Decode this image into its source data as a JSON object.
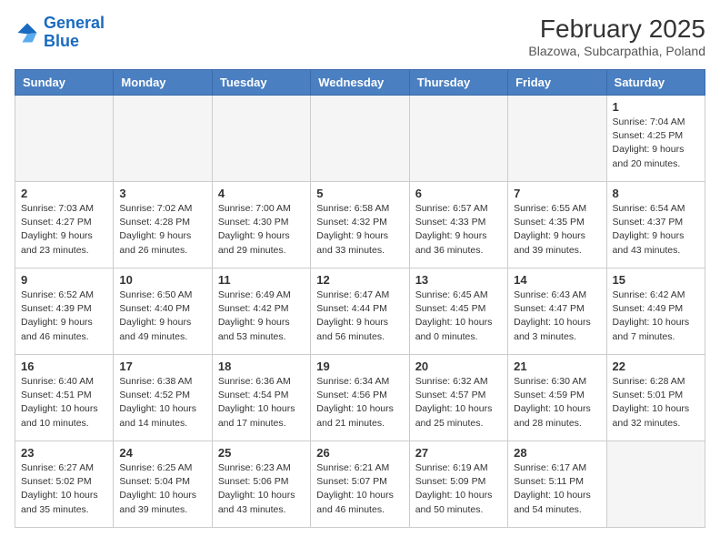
{
  "header": {
    "logo_general": "General",
    "logo_blue": "Blue",
    "month_year": "February 2025",
    "location": "Blazowa, Subcarpathia, Poland"
  },
  "weekdays": [
    "Sunday",
    "Monday",
    "Tuesday",
    "Wednesday",
    "Thursday",
    "Friday",
    "Saturday"
  ],
  "weeks": [
    [
      {
        "day": "",
        "info": ""
      },
      {
        "day": "",
        "info": ""
      },
      {
        "day": "",
        "info": ""
      },
      {
        "day": "",
        "info": ""
      },
      {
        "day": "",
        "info": ""
      },
      {
        "day": "",
        "info": ""
      },
      {
        "day": "1",
        "info": "Sunrise: 7:04 AM\nSunset: 4:25 PM\nDaylight: 9 hours\nand 20 minutes."
      }
    ],
    [
      {
        "day": "2",
        "info": "Sunrise: 7:03 AM\nSunset: 4:27 PM\nDaylight: 9 hours\nand 23 minutes."
      },
      {
        "day": "3",
        "info": "Sunrise: 7:02 AM\nSunset: 4:28 PM\nDaylight: 9 hours\nand 26 minutes."
      },
      {
        "day": "4",
        "info": "Sunrise: 7:00 AM\nSunset: 4:30 PM\nDaylight: 9 hours\nand 29 minutes."
      },
      {
        "day": "5",
        "info": "Sunrise: 6:58 AM\nSunset: 4:32 PM\nDaylight: 9 hours\nand 33 minutes."
      },
      {
        "day": "6",
        "info": "Sunrise: 6:57 AM\nSunset: 4:33 PM\nDaylight: 9 hours\nand 36 minutes."
      },
      {
        "day": "7",
        "info": "Sunrise: 6:55 AM\nSunset: 4:35 PM\nDaylight: 9 hours\nand 39 minutes."
      },
      {
        "day": "8",
        "info": "Sunrise: 6:54 AM\nSunset: 4:37 PM\nDaylight: 9 hours\nand 43 minutes."
      }
    ],
    [
      {
        "day": "9",
        "info": "Sunrise: 6:52 AM\nSunset: 4:39 PM\nDaylight: 9 hours\nand 46 minutes."
      },
      {
        "day": "10",
        "info": "Sunrise: 6:50 AM\nSunset: 4:40 PM\nDaylight: 9 hours\nand 49 minutes."
      },
      {
        "day": "11",
        "info": "Sunrise: 6:49 AM\nSunset: 4:42 PM\nDaylight: 9 hours\nand 53 minutes."
      },
      {
        "day": "12",
        "info": "Sunrise: 6:47 AM\nSunset: 4:44 PM\nDaylight: 9 hours\nand 56 minutes."
      },
      {
        "day": "13",
        "info": "Sunrise: 6:45 AM\nSunset: 4:45 PM\nDaylight: 10 hours\nand 0 minutes."
      },
      {
        "day": "14",
        "info": "Sunrise: 6:43 AM\nSunset: 4:47 PM\nDaylight: 10 hours\nand 3 minutes."
      },
      {
        "day": "15",
        "info": "Sunrise: 6:42 AM\nSunset: 4:49 PM\nDaylight: 10 hours\nand 7 minutes."
      }
    ],
    [
      {
        "day": "16",
        "info": "Sunrise: 6:40 AM\nSunset: 4:51 PM\nDaylight: 10 hours\nand 10 minutes."
      },
      {
        "day": "17",
        "info": "Sunrise: 6:38 AM\nSunset: 4:52 PM\nDaylight: 10 hours\nand 14 minutes."
      },
      {
        "day": "18",
        "info": "Sunrise: 6:36 AM\nSunset: 4:54 PM\nDaylight: 10 hours\nand 17 minutes."
      },
      {
        "day": "19",
        "info": "Sunrise: 6:34 AM\nSunset: 4:56 PM\nDaylight: 10 hours\nand 21 minutes."
      },
      {
        "day": "20",
        "info": "Sunrise: 6:32 AM\nSunset: 4:57 PM\nDaylight: 10 hours\nand 25 minutes."
      },
      {
        "day": "21",
        "info": "Sunrise: 6:30 AM\nSunset: 4:59 PM\nDaylight: 10 hours\nand 28 minutes."
      },
      {
        "day": "22",
        "info": "Sunrise: 6:28 AM\nSunset: 5:01 PM\nDaylight: 10 hours\nand 32 minutes."
      }
    ],
    [
      {
        "day": "23",
        "info": "Sunrise: 6:27 AM\nSunset: 5:02 PM\nDaylight: 10 hours\nand 35 minutes."
      },
      {
        "day": "24",
        "info": "Sunrise: 6:25 AM\nSunset: 5:04 PM\nDaylight: 10 hours\nand 39 minutes."
      },
      {
        "day": "25",
        "info": "Sunrise: 6:23 AM\nSunset: 5:06 PM\nDaylight: 10 hours\nand 43 minutes."
      },
      {
        "day": "26",
        "info": "Sunrise: 6:21 AM\nSunset: 5:07 PM\nDaylight: 10 hours\nand 46 minutes."
      },
      {
        "day": "27",
        "info": "Sunrise: 6:19 AM\nSunset: 5:09 PM\nDaylight: 10 hours\nand 50 minutes."
      },
      {
        "day": "28",
        "info": "Sunrise: 6:17 AM\nSunset: 5:11 PM\nDaylight: 10 hours\nand 54 minutes."
      },
      {
        "day": "",
        "info": ""
      }
    ]
  ]
}
